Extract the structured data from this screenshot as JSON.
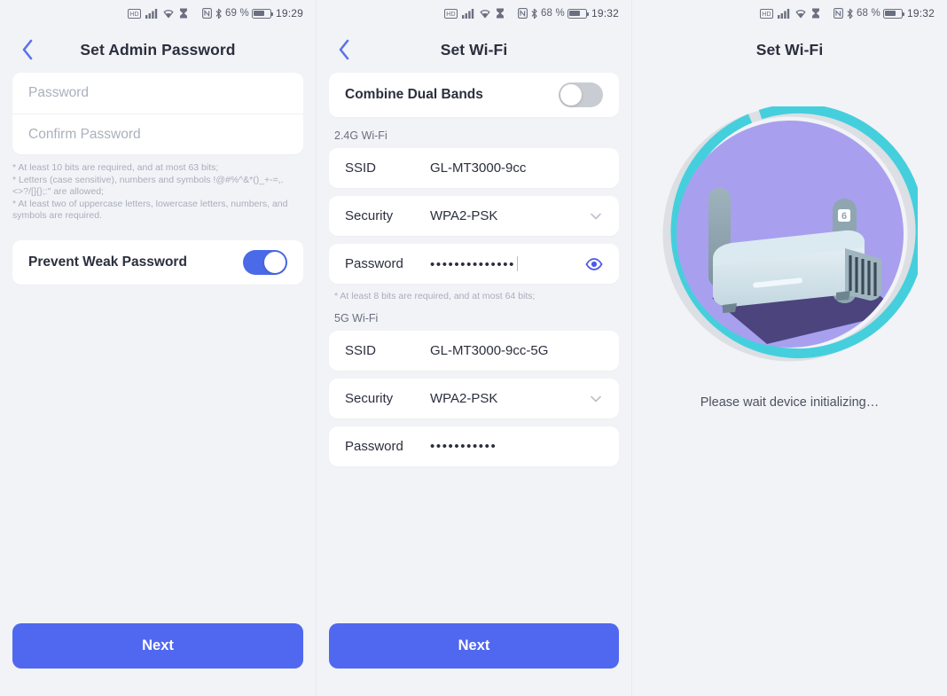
{
  "statusbars": {
    "left": {
      "battery_pct": "69 %",
      "time": "19:29",
      "icons": [
        "hd-icon",
        "signal-icon",
        "wifi-icon",
        "hourglass-icon",
        "nfc-icon",
        "bluetooth-icon",
        "battery-icon"
      ]
    },
    "middle": {
      "battery_pct": "68 %",
      "time": "19:32",
      "icons": [
        "hd-icon",
        "signal-icon",
        "wifi-icon",
        "hourglass-icon",
        "nfc-icon",
        "bluetooth-icon",
        "battery-icon"
      ]
    },
    "right": {
      "battery_pct": "68 %",
      "time": "19:32",
      "icons": [
        "hd-icon",
        "signal-icon",
        "wifi-icon",
        "hourglass-icon",
        "nfc-icon",
        "bluetooth-icon",
        "battery-icon"
      ]
    }
  },
  "screen1": {
    "title": "Set Admin Password",
    "back_icon": "chevron-left-icon",
    "password_placeholder": "Password",
    "confirm_placeholder": "Confirm Password",
    "hint": "* At least 10 bits are required, and at most 63 bits;\n* Letters (case sensitive), numbers and symbols !@#%^&*()_+-=,.<>?/[]{};:\" are allowed;\n* At least two of uppercase letters, lowercase letters, numbers, and symbols are required.",
    "prevent_weak_label": "Prevent Weak Password",
    "prevent_weak_state": "on",
    "next_label": "Next"
  },
  "screen2": {
    "title": "Set Wi-Fi",
    "back_icon": "chevron-left-icon",
    "combine_label": "Combine Dual Bands",
    "combine_state": "off",
    "band24_title": "2.4G Wi-Fi",
    "band24": {
      "ssid_label": "SSID",
      "ssid_value": "GL-MT3000-9cc",
      "security_label": "Security",
      "security_value": "WPA2-PSK",
      "password_label": "Password",
      "password_masked": "••••••••••••••",
      "eye_icon": "eye-icon",
      "chevron_icon": "chevron-down-icon"
    },
    "hint24": "* At least 8 bits are required, and at most 64 bits;",
    "band5_title": "5G Wi-Fi",
    "band5": {
      "ssid_label": "SSID",
      "ssid_value": "GL-MT3000-9cc-5G",
      "security_label": "Security",
      "security_value": "WPA2-PSK",
      "password_label": "Password",
      "password_masked": "•••••••••••",
      "chevron_icon": "chevron-down-icon"
    },
    "next_label": "Next"
  },
  "screen3": {
    "title": "Set Wi-Fi",
    "loading_text": "Please wait device initializing…",
    "illustration": "wifi6-router-illustration",
    "router_badge": "WiFi 6",
    "ring_progress_pct": 90,
    "colors": {
      "ring_active": "#45cfdd",
      "ring_track": "#dcdfe4",
      "disc": "#a8a0ee"
    }
  },
  "theme": {
    "accent": "#5068ef",
    "toggle_on": "#4b6ae8",
    "toggle_off": "#c9ccd3",
    "page_bg": "#f2f3f7",
    "card_bg": "#ffffff",
    "text_primary": "#2b2f3d",
    "text_muted": "#a9aebb"
  }
}
